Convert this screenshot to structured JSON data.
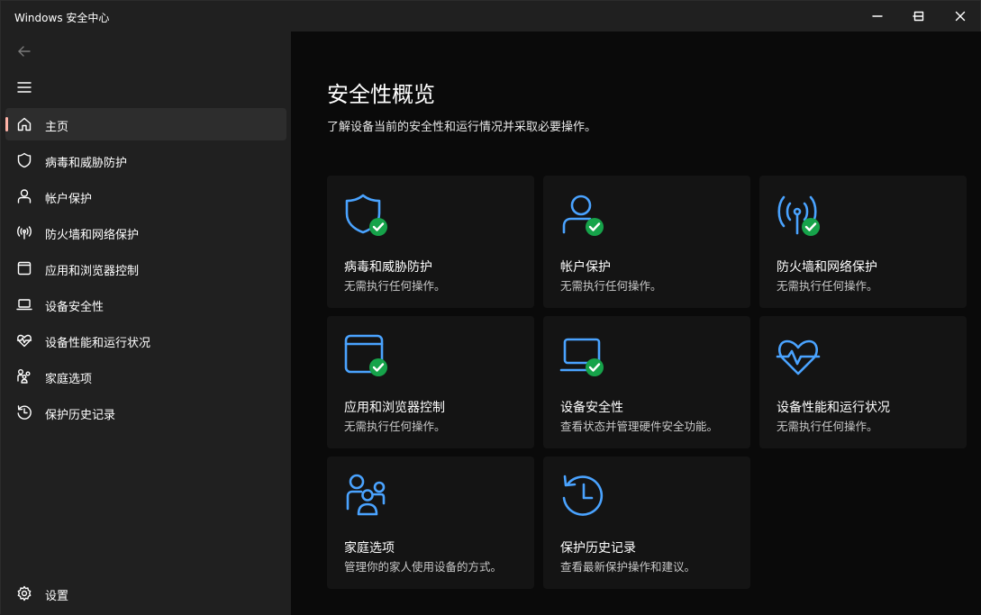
{
  "window": {
    "title": "Windows 安全中心"
  },
  "sidebar": {
    "items": [
      {
        "label": "主页",
        "icon": "home-icon",
        "active": true
      },
      {
        "label": "病毒和威胁防护",
        "icon": "shield-icon"
      },
      {
        "label": "帐户保护",
        "icon": "person-icon"
      },
      {
        "label": "防火墙和网络保护",
        "icon": "wireless-icon"
      },
      {
        "label": "应用和浏览器控制",
        "icon": "app-window-icon"
      },
      {
        "label": "设备安全性",
        "icon": "laptop-icon"
      },
      {
        "label": "设备性能和运行状况",
        "icon": "heart-pulse-icon"
      },
      {
        "label": "家庭选项",
        "icon": "family-icon"
      },
      {
        "label": "保护历史记录",
        "icon": "history-icon"
      }
    ],
    "settings_label": "设置"
  },
  "main": {
    "title": "安全性概览",
    "subtitle": "了解设备当前的安全性和运行情况并采取必要操作。",
    "cards": [
      {
        "title": "病毒和威胁防护",
        "desc": "无需执行任何操作。",
        "icon": "shield-icon",
        "status": "ok"
      },
      {
        "title": "帐户保护",
        "desc": "无需执行任何操作。",
        "icon": "person-icon",
        "status": "ok"
      },
      {
        "title": "防火墙和网络保护",
        "desc": "无需执行任何操作。",
        "icon": "wireless-icon",
        "status": "ok"
      },
      {
        "title": "应用和浏览器控制",
        "desc": "无需执行任何操作。",
        "icon": "app-window-icon",
        "status": "ok"
      },
      {
        "title": "设备安全性",
        "desc": "查看状态并管理硬件安全功能。",
        "icon": "laptop-icon",
        "status": "ok"
      },
      {
        "title": "设备性能和运行状况",
        "desc": "无需执行任何操作。",
        "icon": "heart-pulse-icon"
      },
      {
        "title": "家庭选项",
        "desc": "管理你的家人使用设备的方式。",
        "icon": "family-icon"
      },
      {
        "title": "保护历史记录",
        "desc": "查看最新保护操作和建议。",
        "icon": "history-icon"
      }
    ]
  },
  "colors": {
    "accent": "#4aa3ff",
    "ok": "#16a34a",
    "active_indicator": "#ffb3a7"
  }
}
